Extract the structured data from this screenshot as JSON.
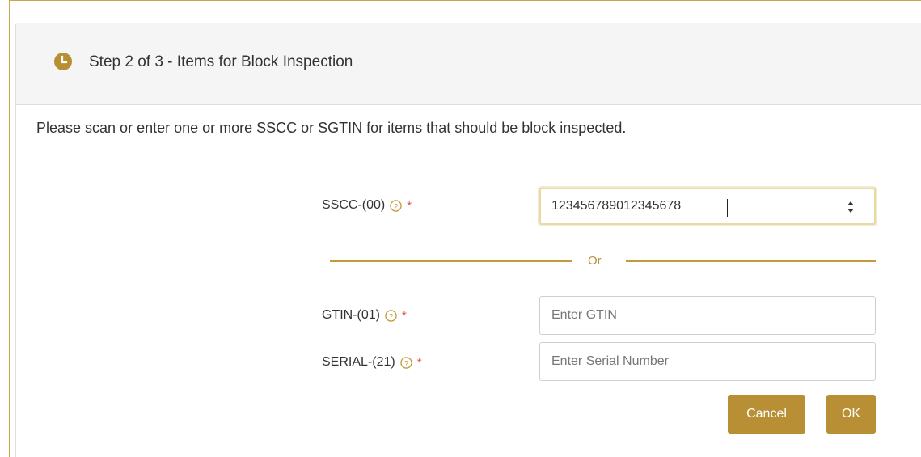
{
  "header": {
    "title": "Step 2 of 3 - Items for Block Inspection",
    "icon": "clock-icon"
  },
  "intro_text": "Please scan or enter one or more SSCC or SGTIN for items that should be block inspected.",
  "fields": {
    "sscc": {
      "label": "SSCC-(00)",
      "required_mark": "*",
      "value": "123456789012345678"
    },
    "divider_label": "Or",
    "gtin": {
      "label": "GTIN-(01)",
      "required_mark": "*",
      "placeholder": "Enter GTIN"
    },
    "serial": {
      "label": "SERIAL-(21)",
      "required_mark": "*",
      "placeholder": "Enter Serial Number"
    }
  },
  "buttons": {
    "cancel": "Cancel",
    "ok": "OK"
  },
  "colors": {
    "accent": "#b88f35",
    "divider": "#c29b3c",
    "required": "#d9534f"
  }
}
